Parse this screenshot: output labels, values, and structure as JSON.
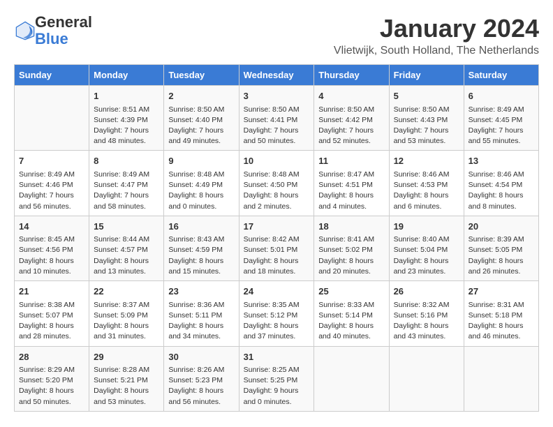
{
  "header": {
    "logo_general": "General",
    "logo_blue": "Blue",
    "month": "January 2024",
    "location": "Vlietwijk, South Holland, The Netherlands"
  },
  "days_of_week": [
    "Sunday",
    "Monday",
    "Tuesday",
    "Wednesday",
    "Thursday",
    "Friday",
    "Saturday"
  ],
  "weeks": [
    [
      {
        "day": "",
        "sunrise": "",
        "sunset": "",
        "daylight": ""
      },
      {
        "day": "1",
        "sunrise": "Sunrise: 8:51 AM",
        "sunset": "Sunset: 4:39 PM",
        "daylight": "Daylight: 7 hours and 48 minutes."
      },
      {
        "day": "2",
        "sunrise": "Sunrise: 8:50 AM",
        "sunset": "Sunset: 4:40 PM",
        "daylight": "Daylight: 7 hours and 49 minutes."
      },
      {
        "day": "3",
        "sunrise": "Sunrise: 8:50 AM",
        "sunset": "Sunset: 4:41 PM",
        "daylight": "Daylight: 7 hours and 50 minutes."
      },
      {
        "day": "4",
        "sunrise": "Sunrise: 8:50 AM",
        "sunset": "Sunset: 4:42 PM",
        "daylight": "Daylight: 7 hours and 52 minutes."
      },
      {
        "day": "5",
        "sunrise": "Sunrise: 8:50 AM",
        "sunset": "Sunset: 4:43 PM",
        "daylight": "Daylight: 7 hours and 53 minutes."
      },
      {
        "day": "6",
        "sunrise": "Sunrise: 8:49 AM",
        "sunset": "Sunset: 4:45 PM",
        "daylight": "Daylight: 7 hours and 55 minutes."
      }
    ],
    [
      {
        "day": "7",
        "sunrise": "Sunrise: 8:49 AM",
        "sunset": "Sunset: 4:46 PM",
        "daylight": "Daylight: 7 hours and 56 minutes."
      },
      {
        "day": "8",
        "sunrise": "Sunrise: 8:49 AM",
        "sunset": "Sunset: 4:47 PM",
        "daylight": "Daylight: 7 hours and 58 minutes."
      },
      {
        "day": "9",
        "sunrise": "Sunrise: 8:48 AM",
        "sunset": "Sunset: 4:49 PM",
        "daylight": "Daylight: 8 hours and 0 minutes."
      },
      {
        "day": "10",
        "sunrise": "Sunrise: 8:48 AM",
        "sunset": "Sunset: 4:50 PM",
        "daylight": "Daylight: 8 hours and 2 minutes."
      },
      {
        "day": "11",
        "sunrise": "Sunrise: 8:47 AM",
        "sunset": "Sunset: 4:51 PM",
        "daylight": "Daylight: 8 hours and 4 minutes."
      },
      {
        "day": "12",
        "sunrise": "Sunrise: 8:46 AM",
        "sunset": "Sunset: 4:53 PM",
        "daylight": "Daylight: 8 hours and 6 minutes."
      },
      {
        "day": "13",
        "sunrise": "Sunrise: 8:46 AM",
        "sunset": "Sunset: 4:54 PM",
        "daylight": "Daylight: 8 hours and 8 minutes."
      }
    ],
    [
      {
        "day": "14",
        "sunrise": "Sunrise: 8:45 AM",
        "sunset": "Sunset: 4:56 PM",
        "daylight": "Daylight: 8 hours and 10 minutes."
      },
      {
        "day": "15",
        "sunrise": "Sunrise: 8:44 AM",
        "sunset": "Sunset: 4:57 PM",
        "daylight": "Daylight: 8 hours and 13 minutes."
      },
      {
        "day": "16",
        "sunrise": "Sunrise: 8:43 AM",
        "sunset": "Sunset: 4:59 PM",
        "daylight": "Daylight: 8 hours and 15 minutes."
      },
      {
        "day": "17",
        "sunrise": "Sunrise: 8:42 AM",
        "sunset": "Sunset: 5:01 PM",
        "daylight": "Daylight: 8 hours and 18 minutes."
      },
      {
        "day": "18",
        "sunrise": "Sunrise: 8:41 AM",
        "sunset": "Sunset: 5:02 PM",
        "daylight": "Daylight: 8 hours and 20 minutes."
      },
      {
        "day": "19",
        "sunrise": "Sunrise: 8:40 AM",
        "sunset": "Sunset: 5:04 PM",
        "daylight": "Daylight: 8 hours and 23 minutes."
      },
      {
        "day": "20",
        "sunrise": "Sunrise: 8:39 AM",
        "sunset": "Sunset: 5:05 PM",
        "daylight": "Daylight: 8 hours and 26 minutes."
      }
    ],
    [
      {
        "day": "21",
        "sunrise": "Sunrise: 8:38 AM",
        "sunset": "Sunset: 5:07 PM",
        "daylight": "Daylight: 8 hours and 28 minutes."
      },
      {
        "day": "22",
        "sunrise": "Sunrise: 8:37 AM",
        "sunset": "Sunset: 5:09 PM",
        "daylight": "Daylight: 8 hours and 31 minutes."
      },
      {
        "day": "23",
        "sunrise": "Sunrise: 8:36 AM",
        "sunset": "Sunset: 5:11 PM",
        "daylight": "Daylight: 8 hours and 34 minutes."
      },
      {
        "day": "24",
        "sunrise": "Sunrise: 8:35 AM",
        "sunset": "Sunset: 5:12 PM",
        "daylight": "Daylight: 8 hours and 37 minutes."
      },
      {
        "day": "25",
        "sunrise": "Sunrise: 8:33 AM",
        "sunset": "Sunset: 5:14 PM",
        "daylight": "Daylight: 8 hours and 40 minutes."
      },
      {
        "day": "26",
        "sunrise": "Sunrise: 8:32 AM",
        "sunset": "Sunset: 5:16 PM",
        "daylight": "Daylight: 8 hours and 43 minutes."
      },
      {
        "day": "27",
        "sunrise": "Sunrise: 8:31 AM",
        "sunset": "Sunset: 5:18 PM",
        "daylight": "Daylight: 8 hours and 46 minutes."
      }
    ],
    [
      {
        "day": "28",
        "sunrise": "Sunrise: 8:29 AM",
        "sunset": "Sunset: 5:20 PM",
        "daylight": "Daylight: 8 hours and 50 minutes."
      },
      {
        "day": "29",
        "sunrise": "Sunrise: 8:28 AM",
        "sunset": "Sunset: 5:21 PM",
        "daylight": "Daylight: 8 hours and 53 minutes."
      },
      {
        "day": "30",
        "sunrise": "Sunrise: 8:26 AM",
        "sunset": "Sunset: 5:23 PM",
        "daylight": "Daylight: 8 hours and 56 minutes."
      },
      {
        "day": "31",
        "sunrise": "Sunrise: 8:25 AM",
        "sunset": "Sunset: 5:25 PM",
        "daylight": "Daylight: 9 hours and 0 minutes."
      },
      {
        "day": "",
        "sunrise": "",
        "sunset": "",
        "daylight": ""
      },
      {
        "day": "",
        "sunrise": "",
        "sunset": "",
        "daylight": ""
      },
      {
        "day": "",
        "sunrise": "",
        "sunset": "",
        "daylight": ""
      }
    ]
  ]
}
